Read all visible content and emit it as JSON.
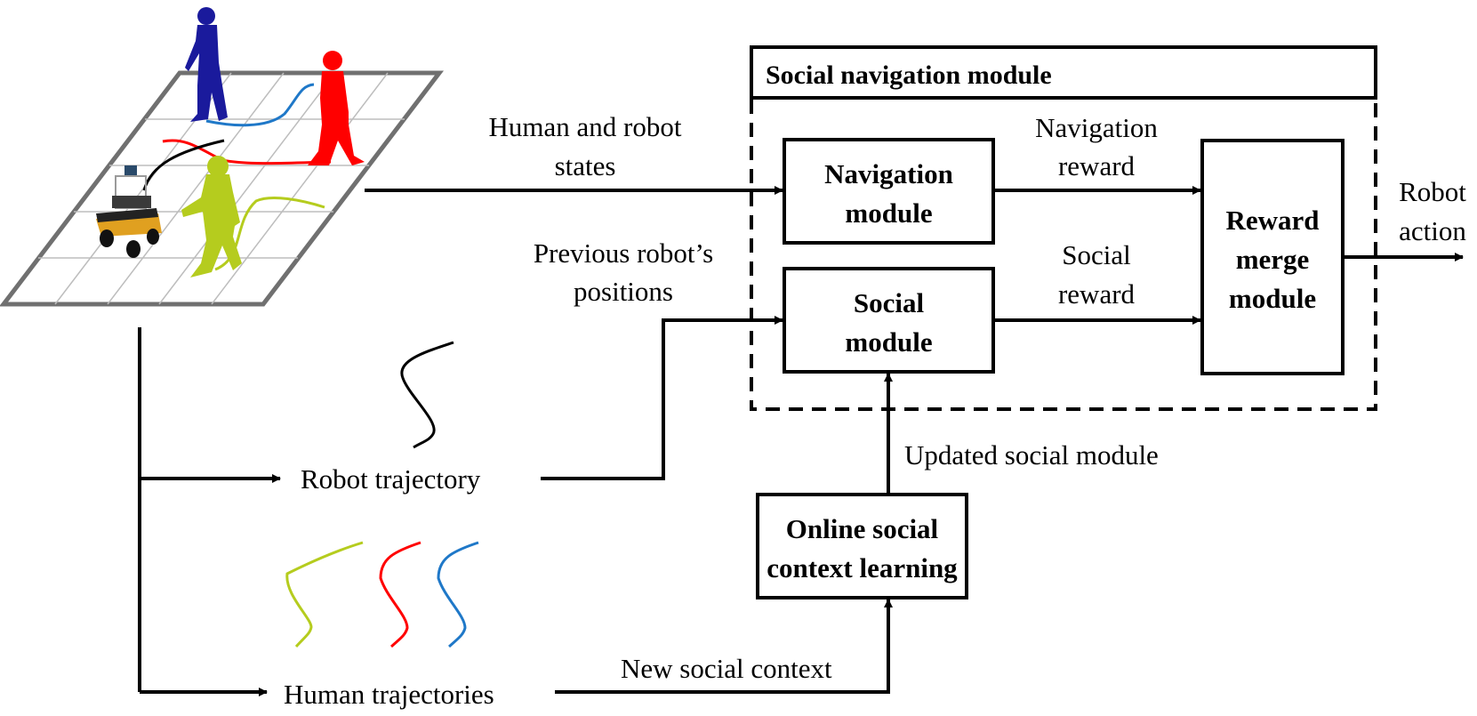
{
  "scene": {
    "description": "Top-down grid floor with robot and three walking humans",
    "humans": [
      {
        "name": "human-blue",
        "color": "#1a1a9c",
        "trajectory_color": "#1f78c8"
      },
      {
        "name": "human-red",
        "color": "#ff0000",
        "trajectory_color": "#ff0000"
      },
      {
        "name": "human-green",
        "color": "#b5cc1e",
        "trajectory_color": "#b5cc1e"
      }
    ],
    "robot_trajectory_color": "#000000",
    "grid_border_color": "#707070",
    "grid_line_color": "#bdbdbd"
  },
  "container": {
    "title": "Social navigation module"
  },
  "modules": {
    "navigation": {
      "line1": "Navigation",
      "line2": "module"
    },
    "social": {
      "line1": "Social",
      "line2": "module"
    },
    "reward_merge": {
      "line1": "Reward",
      "line2": "merge",
      "line3": "module"
    },
    "online_learning": {
      "line1": "Online social",
      "line2": "context learning"
    }
  },
  "edge_labels": {
    "states": {
      "line1": "Human and robot",
      "line2": "states"
    },
    "prev_positions": {
      "line1": "Previous robot’s",
      "line2": "positions"
    },
    "nav_reward": {
      "line1": "Navigation",
      "line2": "reward"
    },
    "social_reward": {
      "line1": "Social",
      "line2": "reward"
    },
    "robot_action": {
      "line1": "Robot",
      "line2": "action"
    },
    "updated_social": "Updated social module",
    "new_context": "New social context",
    "robot_trajectory": "Robot trajectory",
    "human_trajectories": "Human trajectories"
  },
  "colors": {
    "line": "#000000",
    "human_traj": [
      "#b5cc1e",
      "#ff0000",
      "#1f78c8"
    ]
  }
}
